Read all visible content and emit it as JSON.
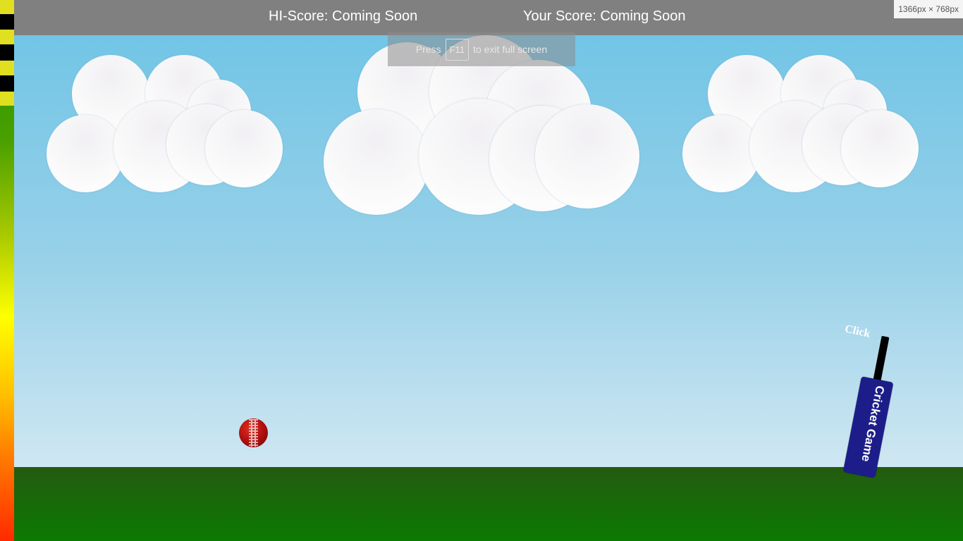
{
  "header": {
    "hi_score": "HI-Score: Coming Soon",
    "your_score": "Your Score: Coming Soon"
  },
  "size_badge": "1366px × 768px",
  "fullscreen_hint": {
    "press": "Press",
    "key": "F11",
    "rest": "to exit full screen"
  },
  "bat": {
    "label": "Cricket Game",
    "click_hint": "Click"
  },
  "colors": {
    "header": "#808080",
    "sky_top": "#72c5e6",
    "sky_bottom": "#cfe7f2",
    "ground": "#0b7a02",
    "bat_blade": "#1d1d8a",
    "ball": "#b01010"
  },
  "icons": [
    "power-meter",
    "cloud",
    "cricket-ball",
    "cricket-bat"
  ]
}
